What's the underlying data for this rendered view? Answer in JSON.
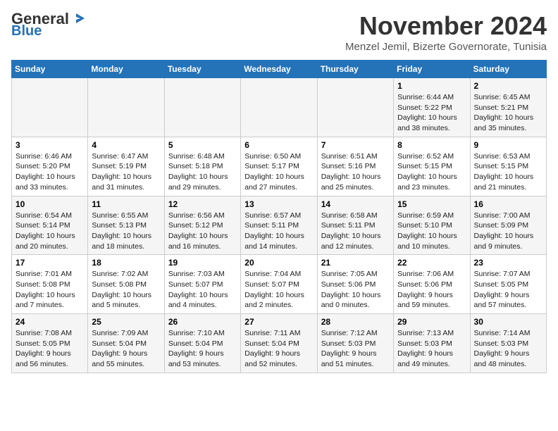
{
  "header": {
    "logo_general": "General",
    "logo_blue": "Blue",
    "month_title": "November 2024",
    "subtitle": "Menzel Jemil, Bizerte Governorate, Tunisia"
  },
  "weekdays": [
    "Sunday",
    "Monday",
    "Tuesday",
    "Wednesday",
    "Thursday",
    "Friday",
    "Saturday"
  ],
  "weeks": [
    [
      {
        "day": "",
        "info": ""
      },
      {
        "day": "",
        "info": ""
      },
      {
        "day": "",
        "info": ""
      },
      {
        "day": "",
        "info": ""
      },
      {
        "day": "",
        "info": ""
      },
      {
        "day": "1",
        "info": "Sunrise: 6:44 AM\nSunset: 5:22 PM\nDaylight: 10 hours and 38 minutes."
      },
      {
        "day": "2",
        "info": "Sunrise: 6:45 AM\nSunset: 5:21 PM\nDaylight: 10 hours and 35 minutes."
      }
    ],
    [
      {
        "day": "3",
        "info": "Sunrise: 6:46 AM\nSunset: 5:20 PM\nDaylight: 10 hours and 33 minutes."
      },
      {
        "day": "4",
        "info": "Sunrise: 6:47 AM\nSunset: 5:19 PM\nDaylight: 10 hours and 31 minutes."
      },
      {
        "day": "5",
        "info": "Sunrise: 6:48 AM\nSunset: 5:18 PM\nDaylight: 10 hours and 29 minutes."
      },
      {
        "day": "6",
        "info": "Sunrise: 6:50 AM\nSunset: 5:17 PM\nDaylight: 10 hours and 27 minutes."
      },
      {
        "day": "7",
        "info": "Sunrise: 6:51 AM\nSunset: 5:16 PM\nDaylight: 10 hours and 25 minutes."
      },
      {
        "day": "8",
        "info": "Sunrise: 6:52 AM\nSunset: 5:15 PM\nDaylight: 10 hours and 23 minutes."
      },
      {
        "day": "9",
        "info": "Sunrise: 6:53 AM\nSunset: 5:15 PM\nDaylight: 10 hours and 21 minutes."
      }
    ],
    [
      {
        "day": "10",
        "info": "Sunrise: 6:54 AM\nSunset: 5:14 PM\nDaylight: 10 hours and 20 minutes."
      },
      {
        "day": "11",
        "info": "Sunrise: 6:55 AM\nSunset: 5:13 PM\nDaylight: 10 hours and 18 minutes."
      },
      {
        "day": "12",
        "info": "Sunrise: 6:56 AM\nSunset: 5:12 PM\nDaylight: 10 hours and 16 minutes."
      },
      {
        "day": "13",
        "info": "Sunrise: 6:57 AM\nSunset: 5:11 PM\nDaylight: 10 hours and 14 minutes."
      },
      {
        "day": "14",
        "info": "Sunrise: 6:58 AM\nSunset: 5:11 PM\nDaylight: 10 hours and 12 minutes."
      },
      {
        "day": "15",
        "info": "Sunrise: 6:59 AM\nSunset: 5:10 PM\nDaylight: 10 hours and 10 minutes."
      },
      {
        "day": "16",
        "info": "Sunrise: 7:00 AM\nSunset: 5:09 PM\nDaylight: 10 hours and 9 minutes."
      }
    ],
    [
      {
        "day": "17",
        "info": "Sunrise: 7:01 AM\nSunset: 5:08 PM\nDaylight: 10 hours and 7 minutes."
      },
      {
        "day": "18",
        "info": "Sunrise: 7:02 AM\nSunset: 5:08 PM\nDaylight: 10 hours and 5 minutes."
      },
      {
        "day": "19",
        "info": "Sunrise: 7:03 AM\nSunset: 5:07 PM\nDaylight: 10 hours and 4 minutes."
      },
      {
        "day": "20",
        "info": "Sunrise: 7:04 AM\nSunset: 5:07 PM\nDaylight: 10 hours and 2 minutes."
      },
      {
        "day": "21",
        "info": "Sunrise: 7:05 AM\nSunset: 5:06 PM\nDaylight: 10 hours and 0 minutes."
      },
      {
        "day": "22",
        "info": "Sunrise: 7:06 AM\nSunset: 5:06 PM\nDaylight: 9 hours and 59 minutes."
      },
      {
        "day": "23",
        "info": "Sunrise: 7:07 AM\nSunset: 5:05 PM\nDaylight: 9 hours and 57 minutes."
      }
    ],
    [
      {
        "day": "24",
        "info": "Sunrise: 7:08 AM\nSunset: 5:05 PM\nDaylight: 9 hours and 56 minutes."
      },
      {
        "day": "25",
        "info": "Sunrise: 7:09 AM\nSunset: 5:04 PM\nDaylight: 9 hours and 55 minutes."
      },
      {
        "day": "26",
        "info": "Sunrise: 7:10 AM\nSunset: 5:04 PM\nDaylight: 9 hours and 53 minutes."
      },
      {
        "day": "27",
        "info": "Sunrise: 7:11 AM\nSunset: 5:04 PM\nDaylight: 9 hours and 52 minutes."
      },
      {
        "day": "28",
        "info": "Sunrise: 7:12 AM\nSunset: 5:03 PM\nDaylight: 9 hours and 51 minutes."
      },
      {
        "day": "29",
        "info": "Sunrise: 7:13 AM\nSunset: 5:03 PM\nDaylight: 9 hours and 49 minutes."
      },
      {
        "day": "30",
        "info": "Sunrise: 7:14 AM\nSunset: 5:03 PM\nDaylight: 9 hours and 48 minutes."
      }
    ]
  ]
}
